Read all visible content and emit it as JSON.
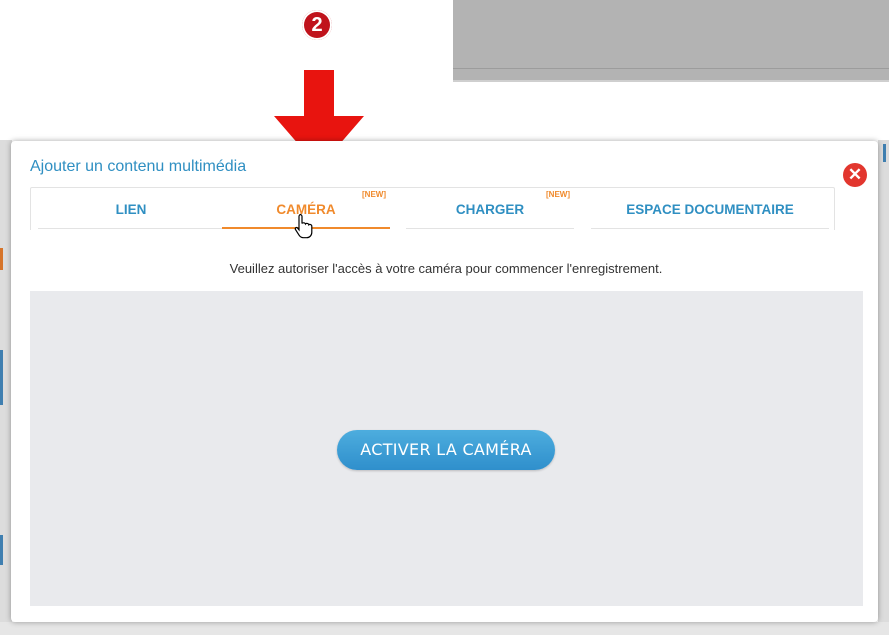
{
  "annotation": {
    "step_number": "2",
    "arrow_color": "#e8140f",
    "badge_color": "#c0121b"
  },
  "modal": {
    "title": "Ajouter un contenu multimédia",
    "close_icon": "close-icon",
    "tabs": [
      {
        "label": "LIEN",
        "badge": "",
        "active": false
      },
      {
        "label": "CAMÉRA",
        "badge": "[NEW]",
        "active": true
      },
      {
        "label": "CHARGER",
        "badge": "[NEW]",
        "active": false
      },
      {
        "label": "ESPACE DOCUMENTAIRE",
        "badge": "",
        "active": false
      }
    ],
    "instruction": "Veuillez autoriser l'accès à votre caméra pour commencer l'enregistrement.",
    "activate_button": "ACTIVER LA CAMÉRA"
  },
  "colors": {
    "accent_blue": "#2f8fc2",
    "active_orange": "#f08a2c",
    "close_red": "#e2362e",
    "camera_area": "#e9eaed"
  }
}
